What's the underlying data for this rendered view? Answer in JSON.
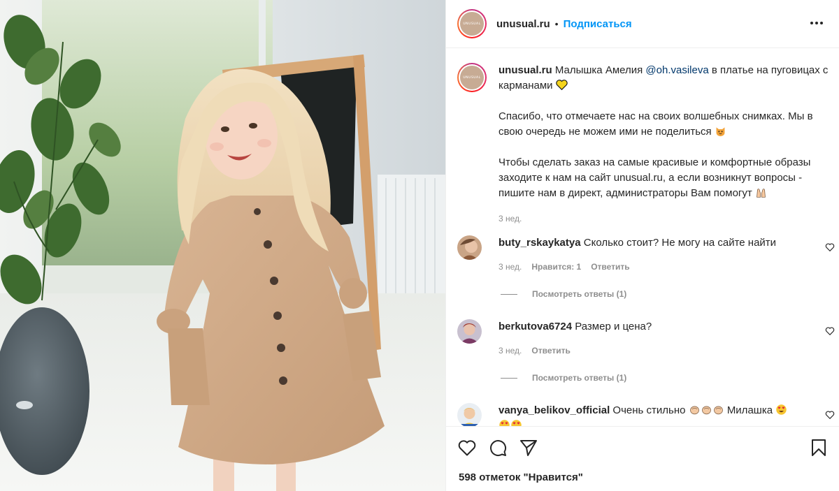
{
  "post": {
    "account": {
      "username": "unusual.ru",
      "avatar_text": "UNUSUAL",
      "separator": "•",
      "follow_label": "Подписаться"
    },
    "caption": {
      "username": "unusual.ru",
      "text_before_mention": "Малышка Амелия",
      "mention": "@oh.vasileva",
      "text_after_mention": "в платье на пуговицах с карманами",
      "paragraph_2": "Спасибо, что отмечаете нас на своих волшебных снимках. Мы в свою очередь не можем ими не поделиться",
      "paragraph_3": "Чтобы сделать заказ на самые красивые и комфортные образы заходите к нам на сайт unusual.ru, а если возникнут вопросы - пишите нам в директ, администраторы Вам помогут",
      "time": "3 нед."
    },
    "comments": [
      {
        "username": "buty_rskaykatya",
        "text": "Сколько стоит? Не могу на сайте найти",
        "time": "3 нед.",
        "likes": "Нравится: 1",
        "reply_label": "Ответить",
        "view_replies": "Посмотреть ответы (1)"
      },
      {
        "username": "berkutova6724",
        "text": "Размер и цена?",
        "time": "3 нед.",
        "reply_label": "Ответить",
        "view_replies": "Посмотреть ответы (1)"
      },
      {
        "username": "vanya_belikov_official",
        "text_before": "Очень стильно",
        "text_after": "Милашка"
      }
    ],
    "likes_count": "598 отметок \"Нравится\""
  },
  "icons": {
    "more": "more-options-icon",
    "like": "heart-icon",
    "comment": "comment-icon",
    "share": "share-icon",
    "save": "bookmark-icon"
  },
  "colors": {
    "follow": "#0095f6",
    "text": "#262626",
    "secondary": "#8e8e8e",
    "mention": "#00376b"
  }
}
